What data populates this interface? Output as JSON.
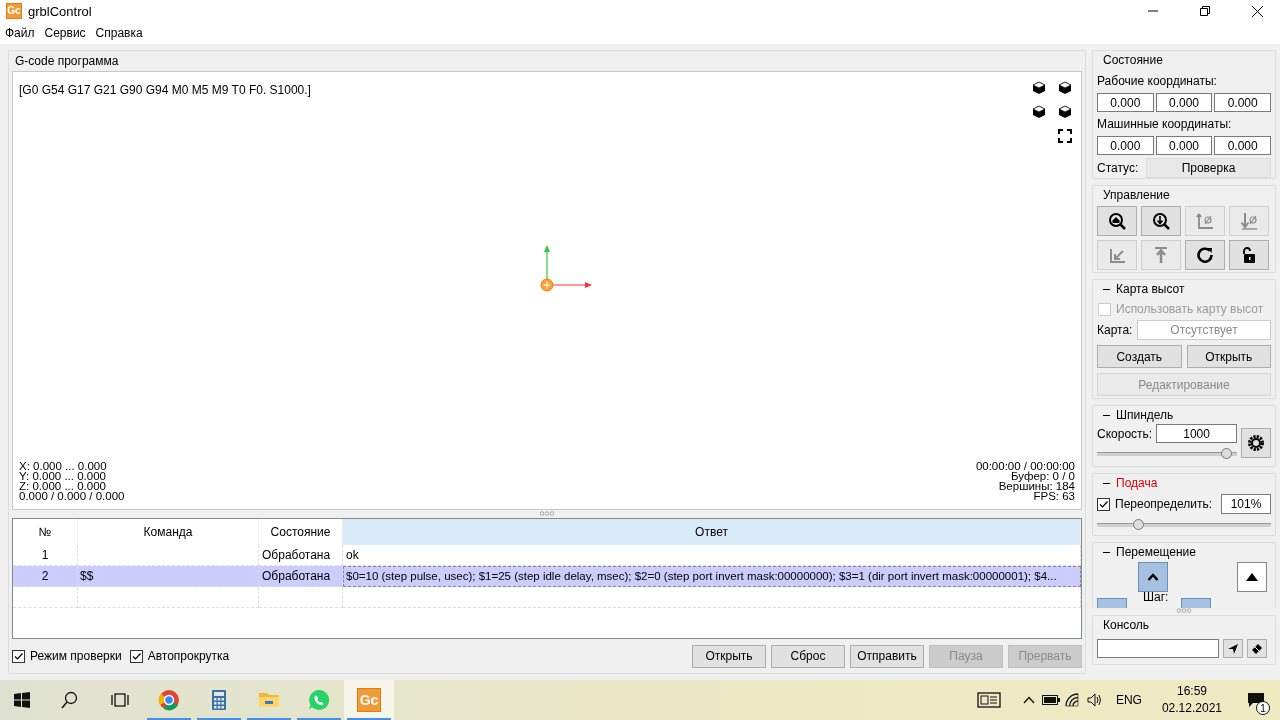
{
  "window": {
    "icon_text": "Gc",
    "title": "grblControl"
  },
  "menu": [
    "Файл",
    "Сервис",
    "Справка"
  ],
  "program": {
    "title": "G-code программа",
    "status_line": "[G0 G54 G17 G21 G90 G94 M0 M5 M9 T0 F0. S1000.]",
    "bounds": [
      "X: 0.000 ... 0.000",
      "Y: 0.000 ... 0.000",
      "Z: 0.000 ... 0.000",
      "0.000 / 0.000 / 0.000"
    ],
    "stats": [
      "00:00:00 / 00:00:00",
      "Буфер: 0 / 0",
      "Вершины: 184",
      "FPS: 63"
    ]
  },
  "table": {
    "columns": [
      {
        "label": "№",
        "selected": false
      },
      {
        "label": "Команда",
        "selected": false
      },
      {
        "label": "Состояние",
        "selected": false
      },
      {
        "label": "Ответ",
        "selected": true
      }
    ],
    "rows": [
      {
        "number": "1",
        "state": "Обработана",
        "response": "ok",
        "selected": false
      },
      {
        "number": "2",
        "command": "$$",
        "state": "Обработана",
        "response": "$0=10 (step pulse, usec); $1=25 (step idle delay, msec); $2=0 (step port invert mask:00000000); $3=1 (dir port invert mask:00000001); $4...",
        "selected": true
      }
    ]
  },
  "options": [
    {
      "label": "Режим проверки",
      "checked": true
    },
    {
      "label": "Автопрокрутка",
      "checked": true
    }
  ],
  "buttons": [
    {
      "label": "Открыть",
      "disabled": false
    },
    {
      "label": "Сброс",
      "disabled": false
    },
    {
      "label": "Отправить",
      "disabled": false
    },
    {
      "label": "Пауза",
      "disabled": true
    },
    {
      "label": "Прервать",
      "disabled": true
    }
  ],
  "state": {
    "title": "Состояние",
    "work_label": "Рабочие координаты:",
    "work": [
      "0.000",
      "0.000",
      "0.000"
    ],
    "machine_label": "Машинные координаты:",
    "machine": [
      "0.000",
      "0.000",
      "0.000"
    ],
    "status_label": "Статус:",
    "status": "Проверка"
  },
  "control": {
    "title": "Управление",
    "buttons": [
      {
        "kind": "home",
        "disabled": false
      },
      {
        "kind": "probe",
        "disabled": false
      },
      {
        "kind": "zero_xy",
        "disabled": true
      },
      {
        "kind": "zero_z",
        "disabled": true
      },
      {
        "kind": "return_xy",
        "disabled": true
      },
      {
        "kind": "safe_z",
        "disabled": true
      },
      {
        "kind": "reset",
        "disabled": false
      },
      {
        "kind": "unlock",
        "disabled": false
      }
    ]
  },
  "heightmap": {
    "title": "Карта высот",
    "expanded": true,
    "use_label": "Использовать карту высот",
    "use_checked": false,
    "use_disabled": true,
    "map_label": "Карта:",
    "map_value": "Отсутствует",
    "buttons": [
      {
        "label": "Создать",
        "disabled": false
      },
      {
        "label": "Открыть",
        "disabled": false
      },
      {
        "label": "Редактирование",
        "disabled": true
      }
    ]
  },
  "spindle": {
    "title": "Шпиндель",
    "expanded": true,
    "speed_label": "Скорость:",
    "speed": "1000",
    "level": 0.96
  },
  "feed": {
    "title": "Подача",
    "expanded": true,
    "highlighted": true,
    "override_label": "Переопределить:",
    "override_checked": true,
    "value": "101%",
    "level": 0.22
  },
  "jog": {
    "title": "Перемещение",
    "expanded": true,
    "step_label": "Шаг:"
  },
  "console": {
    "title": "Консоль"
  },
  "taskbar": {
    "apps": [
      {
        "kind": "browser",
        "running": true,
        "active": false
      },
      {
        "kind": "calculator",
        "running": true,
        "active": false
      },
      {
        "kind": "folder",
        "running": true,
        "active": false
      },
      {
        "kind": "chat",
        "running": true,
        "active": false
      },
      {
        "kind": "grbl",
        "label": "Gc",
        "running": true,
        "active": true
      }
    ],
    "language": "ENG",
    "time": "16:59",
    "date": "02.12.2021",
    "notifications": "1"
  }
}
